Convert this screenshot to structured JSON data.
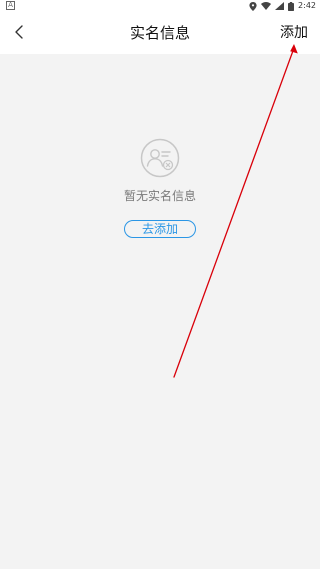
{
  "status_bar": {
    "left_badge": "A",
    "time": "2:42",
    "icons": [
      "location-icon",
      "wifi-icon",
      "signal-icon",
      "battery-icon"
    ]
  },
  "nav_bar": {
    "title": "实名信息",
    "add_label": "添加",
    "back_icon": "chevron-left-icon"
  },
  "empty_state": {
    "icon": "id-card-icon",
    "message": "暂无实名信息",
    "button_label": "去添加"
  },
  "annotation": {
    "type": "arrow",
    "color": "#d9000a",
    "points_to": "add-button"
  },
  "colors": {
    "accent": "#2b96e5",
    "background": "#f3f3f3",
    "nav_background": "#ffffff"
  }
}
